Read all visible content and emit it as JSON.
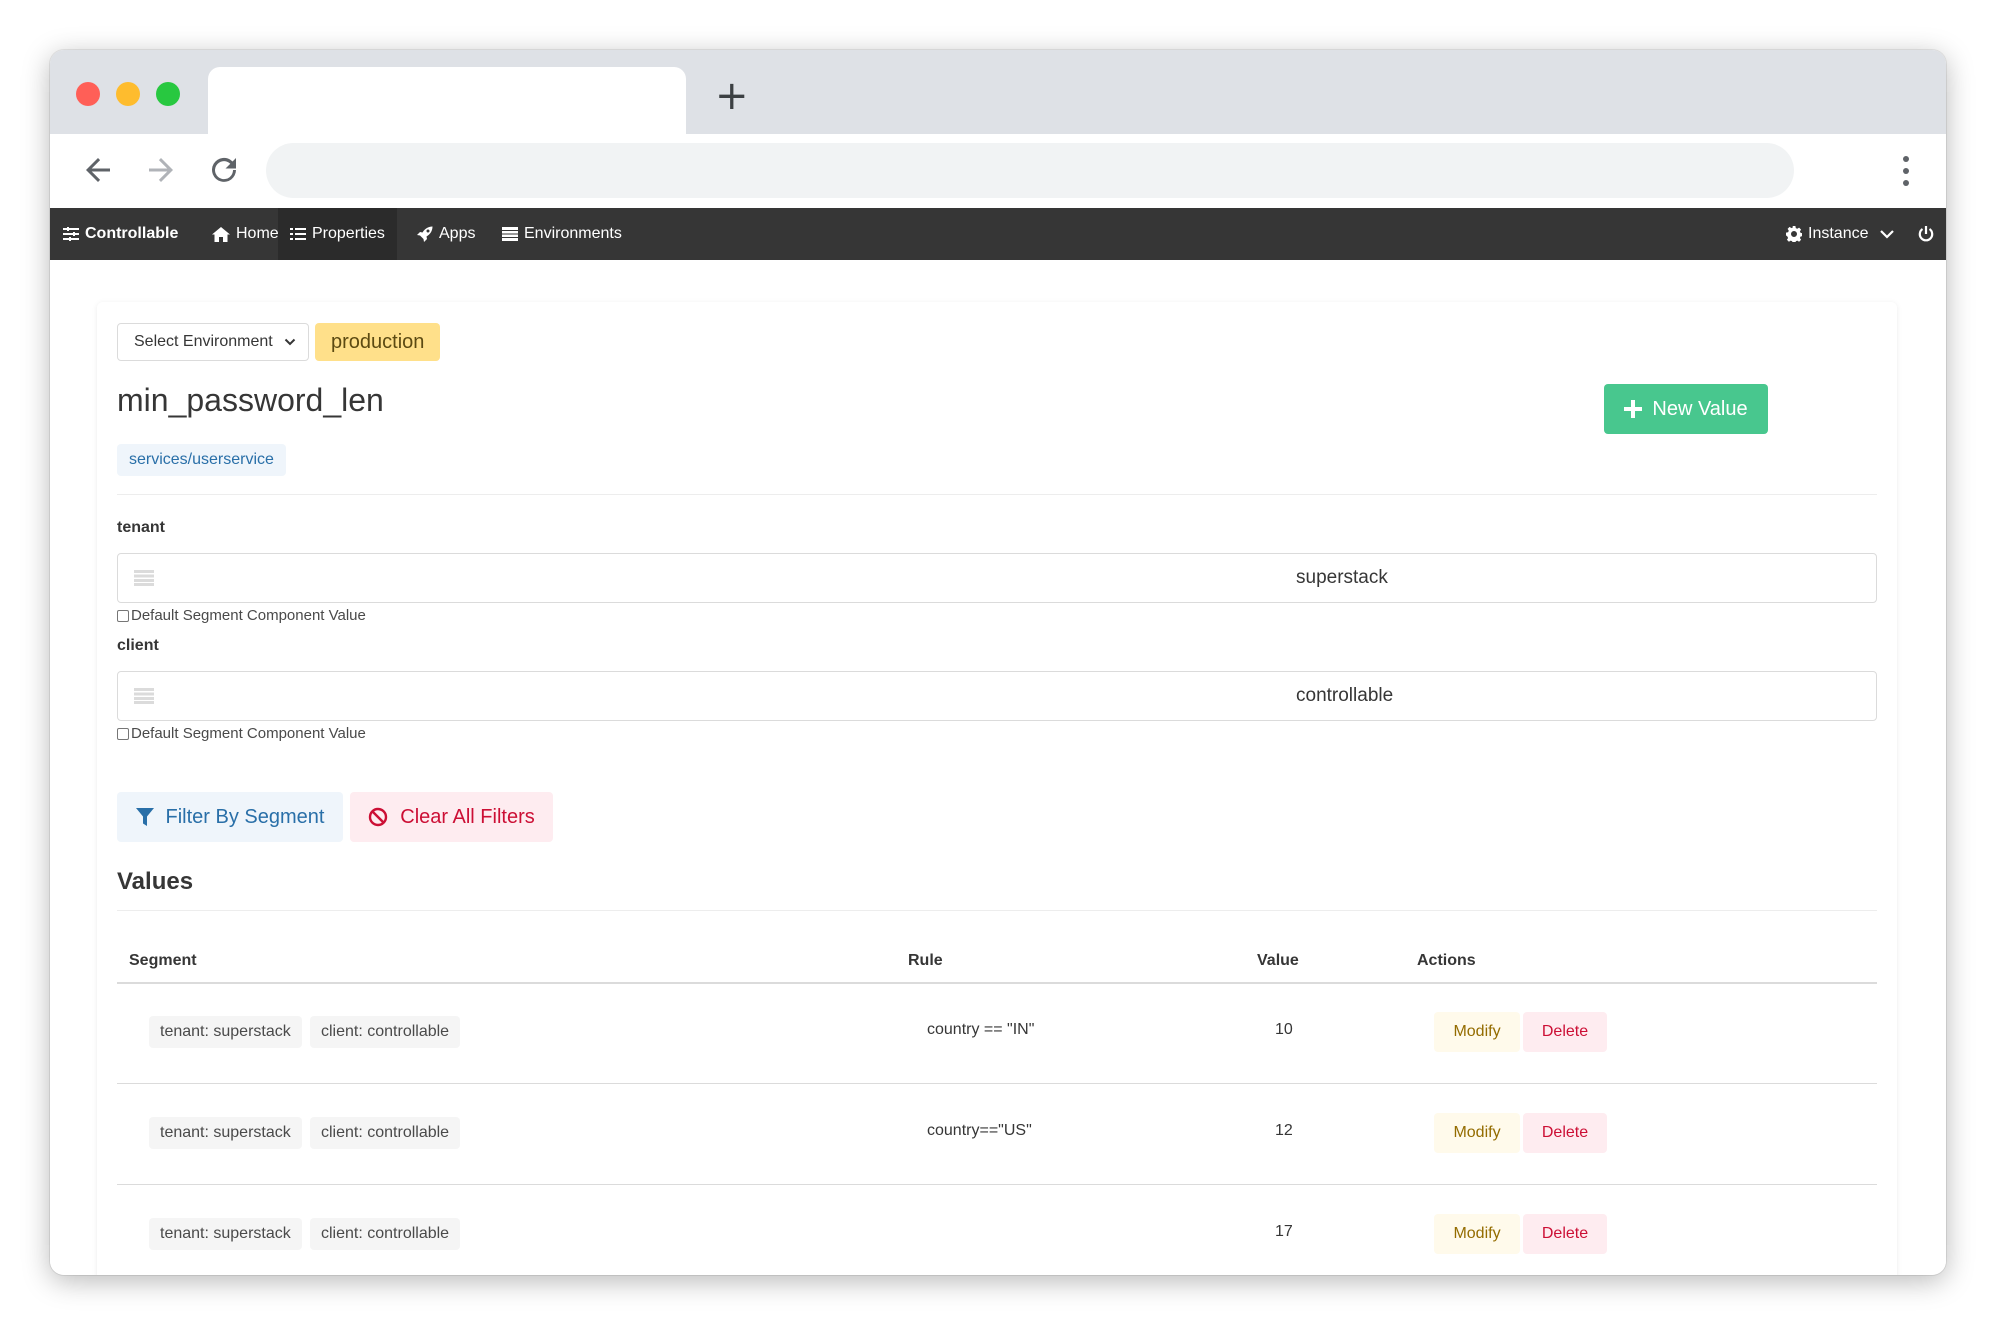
{
  "browser": {
    "new_tab_symbol": "+"
  },
  "navbar": {
    "brand": "Controllable",
    "items": [
      {
        "label": "Home",
        "icon": "home-icon"
      },
      {
        "label": "Properties",
        "icon": "list-icon"
      },
      {
        "label": "Apps",
        "icon": "rocket-icon"
      },
      {
        "label": "Environments",
        "icon": "table-icon"
      }
    ],
    "instance_label": "Instance",
    "power_icon": "power-icon"
  },
  "header": {
    "environment_select_label": "Select Environment",
    "environment_tag": "production",
    "property_name": "min_password_len",
    "property_path": "services/userservice",
    "new_value_label": "New Value"
  },
  "segment_filters": [
    {
      "label": "tenant",
      "value": "superstack",
      "default_label": "Default Segment Component Value"
    },
    {
      "label": "client",
      "value": "controllable",
      "default_label": "Default Segment Component Value"
    }
  ],
  "filter_buttons": {
    "filter_label": "Filter By Segment",
    "clear_label": "Clear All Filters"
  },
  "values": {
    "title": "Values",
    "columns": [
      "Segment",
      "Rule",
      "Value",
      "Actions"
    ],
    "rows": [
      {
        "segments": [
          "tenant: superstack",
          "client: controllable"
        ],
        "rule": "country == \"IN\"",
        "value": "10",
        "modify": "Modify",
        "delete": "Delete"
      },
      {
        "segments": [
          "tenant: superstack",
          "client: controllable"
        ],
        "rule": "country==\"US\"",
        "value": "12",
        "modify": "Modify",
        "delete": "Delete"
      },
      {
        "segments": [
          "tenant: superstack",
          "client: controllable"
        ],
        "rule": "",
        "value": "17",
        "modify": "Modify",
        "delete": "Delete"
      }
    ]
  },
  "colors": {
    "navbar": "#363636",
    "success": "#48c78e",
    "warning_tag": "#ffe08a",
    "info_light": "#eff5fb",
    "danger_light": "#feecf0"
  }
}
